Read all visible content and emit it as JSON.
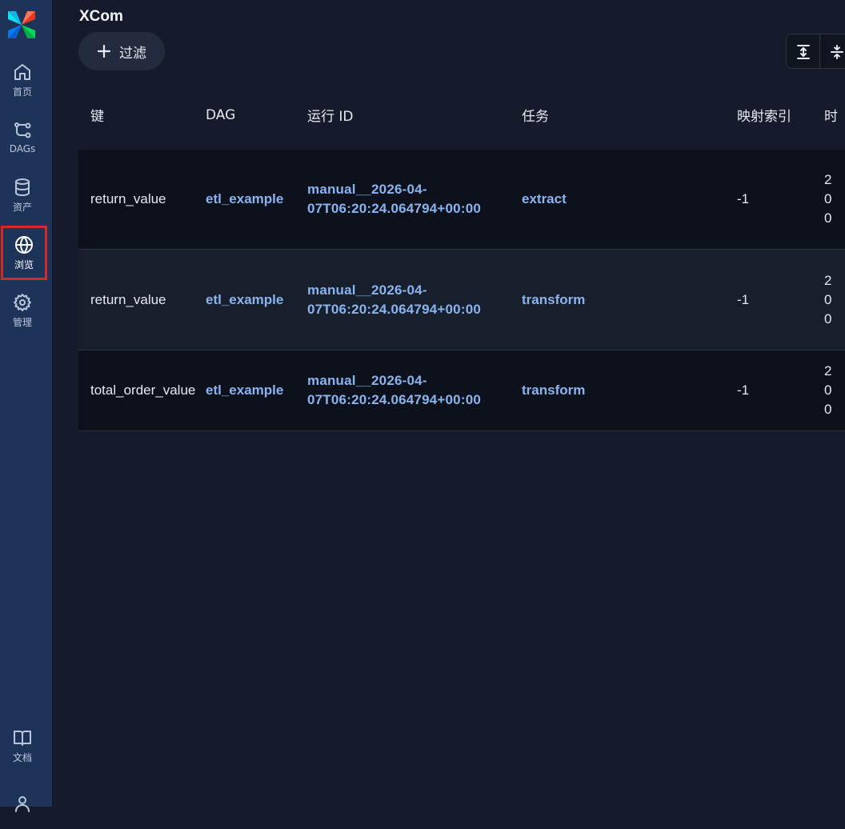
{
  "sidebar": {
    "items": [
      {
        "label": "首页",
        "icon": "home-icon"
      },
      {
        "label": "DAGs",
        "icon": "dag-icon"
      },
      {
        "label": "资产",
        "icon": "database-icon"
      },
      {
        "label": "浏览",
        "icon": "globe-icon",
        "active": true
      },
      {
        "label": "管理",
        "icon": "gear-icon"
      },
      {
        "label": "文档",
        "icon": "book-icon"
      },
      {
        "label": "",
        "icon": "user-icon"
      }
    ]
  },
  "page": {
    "title": "XCom",
    "filter_label": "过滤"
  },
  "table": {
    "headers": [
      "键",
      "DAG",
      "运行 ID",
      "任务",
      "映射索引",
      "时"
    ],
    "rows": [
      {
        "key": "return_value",
        "dag": "etl_example",
        "run_id_1": "manual__2026-04-",
        "run_id_2": "07T06:20:24.064794+00:00",
        "task": "extract",
        "map_index": "-1",
        "ts_1": "2",
        "ts_2": "0",
        "ts_3": "0"
      },
      {
        "key": "return_value",
        "dag": "etl_example",
        "run_id_1": "manual__2026-04-",
        "run_id_2": "07T06:20:24.064794+00:00",
        "task": "transform",
        "map_index": "-1",
        "ts_1": "2",
        "ts_2": "0",
        "ts_3": "0"
      },
      {
        "key": "total_order_value",
        "dag": "etl_example",
        "run_id_1": "manual__2026-04-",
        "run_id_2": "07T06:20:24.064794+00:00",
        "task": "transform",
        "map_index": "-1",
        "ts_1": "2",
        "ts_2": "0",
        "ts_3": "0"
      }
    ]
  }
}
